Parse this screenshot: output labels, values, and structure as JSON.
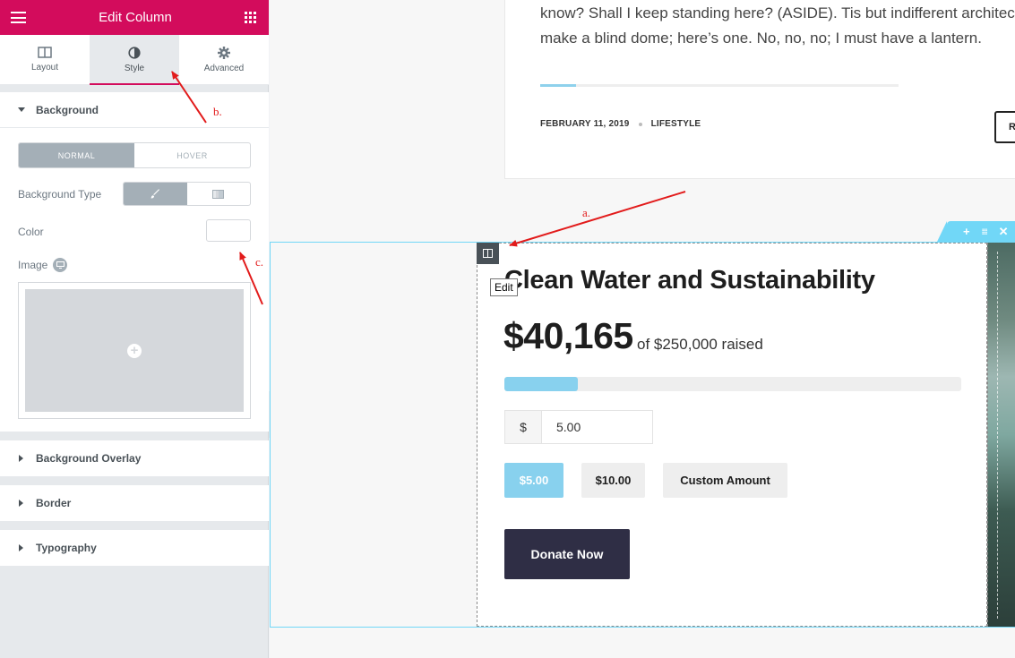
{
  "panel": {
    "title": "Edit Column",
    "tabs": [
      {
        "label": "Layout",
        "icon": "columns-icon"
      },
      {
        "label": "Style",
        "icon": "contrast-icon",
        "active": true
      },
      {
        "label": "Advanced",
        "icon": "gear-icon"
      }
    ],
    "background": {
      "heading": "Background",
      "state_normal": "NORMAL",
      "state_hover": "HOVER",
      "type_label": "Background Type",
      "type_options": [
        "brush-icon",
        "gradient-icon"
      ],
      "color_label": "Color",
      "image_label": "Image"
    },
    "sections": {
      "overlay": "Background Overlay",
      "border": "Border",
      "typography": "Typography"
    }
  },
  "post": {
    "excerpt_line1": "know? Shall I keep standing here? (ASIDE). Tis but indifferent architecture.",
    "excerpt_line2": "make a blind dome; here’s one. No, no, no; I must have a lantern.",
    "date": "FEBRUARY 11, 2019",
    "category": "LIFESTYLE",
    "read_more": "R"
  },
  "column": {
    "edit_tooltip": "Edit"
  },
  "campaign": {
    "title": "Clean Water and Sustainability",
    "raised": "$40,165",
    "goal_text": "of $250,000 raised",
    "progress_fraction": 0.16,
    "currency": "$",
    "amount": "5.00",
    "presets": [
      "$5.00",
      "$10.00",
      "Custom Amount"
    ],
    "donate_label": "Donate Now"
  },
  "annotations": {
    "a": "a.",
    "b": "b.",
    "c": "c."
  },
  "colors": {
    "brand": "#d30c5c",
    "section_outline": "#71d7f7",
    "progress_fill": "#88d1ee",
    "donate_button": "#2f2e45",
    "annotation": "#e21b1b"
  }
}
